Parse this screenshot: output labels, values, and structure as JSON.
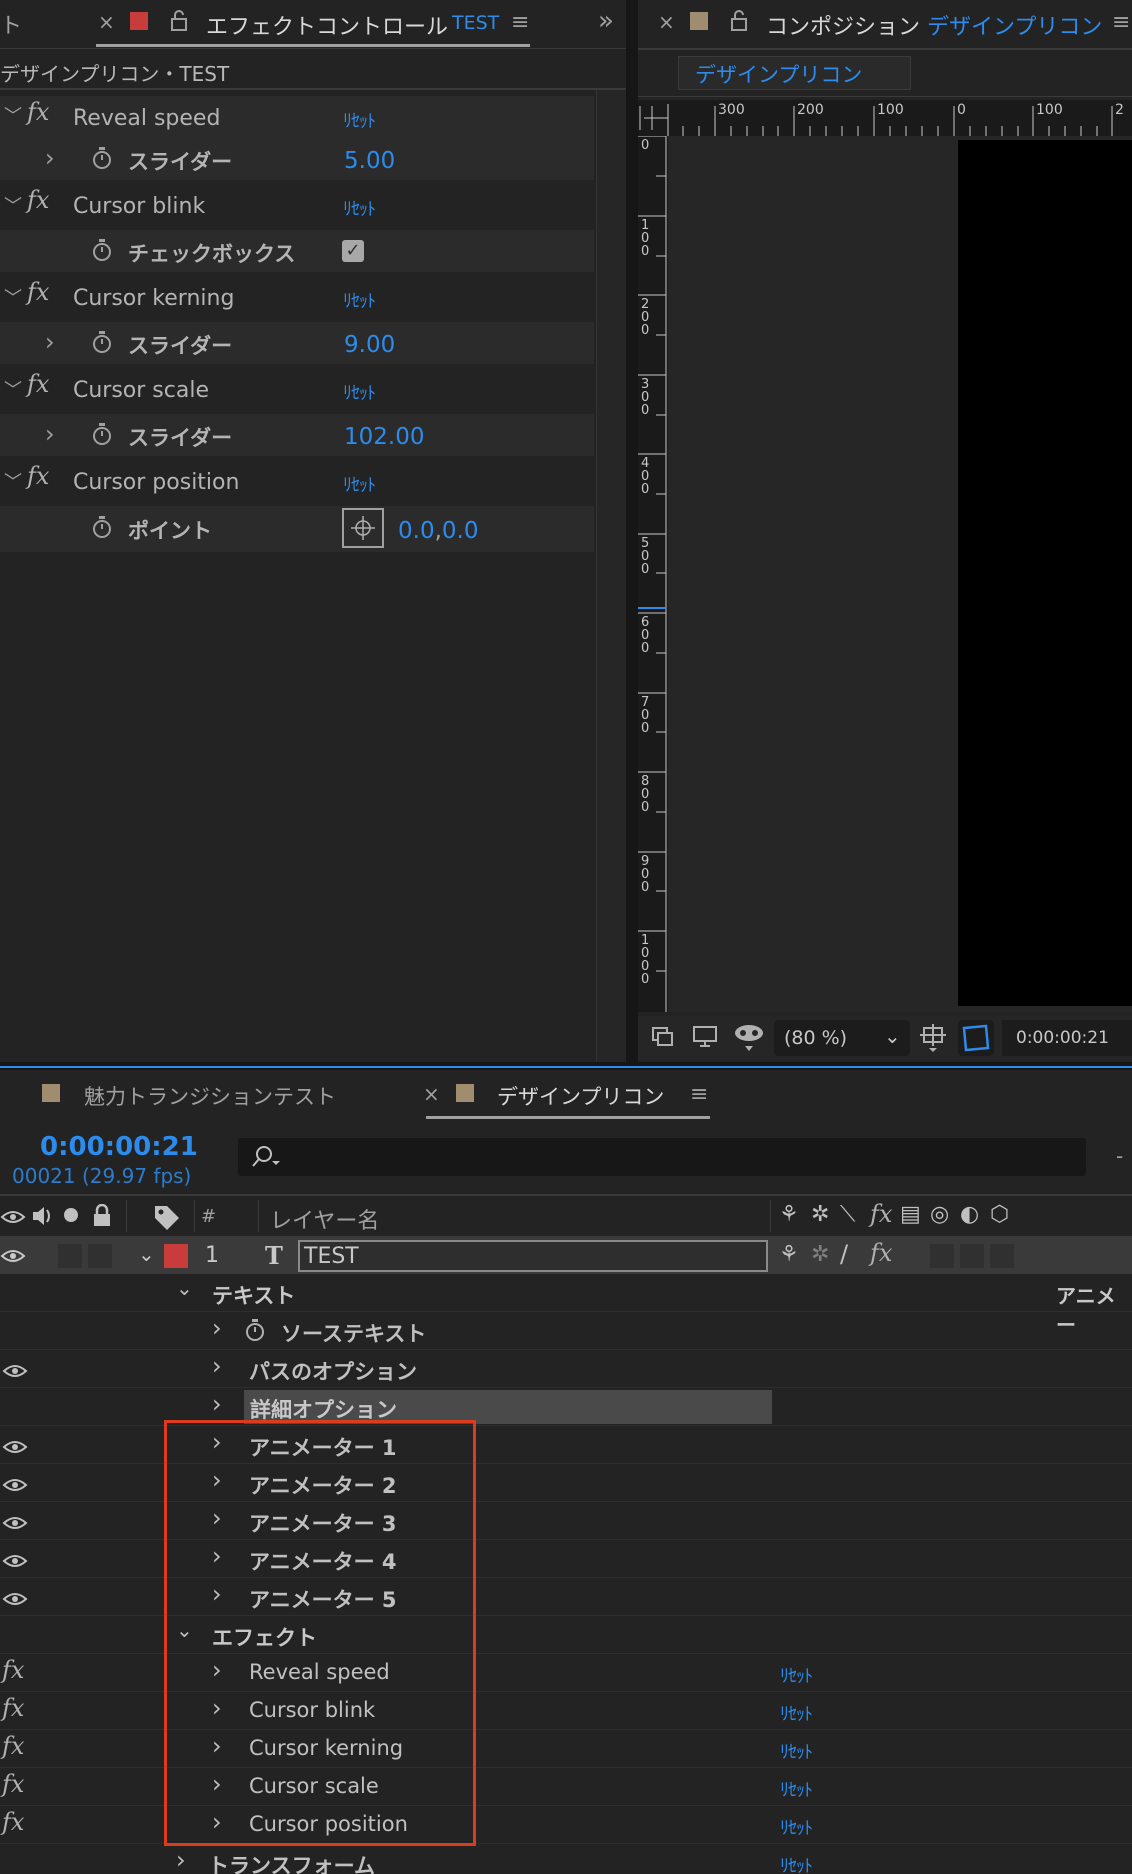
{
  "effect_controls": {
    "tab_left_cut": "ト",
    "tab_title": "エフェクトコントロール",
    "tab_layer": "TEST",
    "breadcrumb": "デザインプリコン・TEST",
    "effects": [
      {
        "name": "Reveal speed",
        "reset": "ﾘｾｯﾄ",
        "param": "スライダー",
        "value": "5.00"
      },
      {
        "name": "Cursor blink",
        "reset": "ﾘｾｯﾄ",
        "param": "チェックボックス",
        "value": "checked"
      },
      {
        "name": "Cursor kerning",
        "reset": "ﾘｾｯﾄ",
        "param": "スライダー",
        "value": "9.00"
      },
      {
        "name": "Cursor scale",
        "reset": "ﾘｾｯﾄ",
        "param": "スライダー",
        "value": "102.00"
      },
      {
        "name": "Cursor position",
        "reset": "ﾘｾｯﾄ",
        "param": "ポイント",
        "value_x": "0.0",
        "value_sep": ",",
        "value_y": "0.0"
      }
    ]
  },
  "composition": {
    "tab_title": "コンポジション",
    "comp_name": "デザインプリコン",
    "flowchart_tab": "デザインプリコン",
    "ruler_h": [
      "300",
      "200",
      "100",
      "0",
      "100",
      "2"
    ],
    "ruler_v": [
      "0",
      "100",
      "200",
      "300",
      "400",
      "500",
      "600",
      "700",
      "800",
      "900",
      "1000"
    ],
    "zoom": "(80 %)",
    "timecode": "0:00:00:21"
  },
  "timeline": {
    "tabs": [
      {
        "label": "魅力トランジションテスト",
        "color": "#a08c6e"
      },
      {
        "label": "デザインプリコン",
        "color": "#a08c6e"
      }
    ],
    "timecode": "0:00:00:21",
    "frame_info": "00021 (29.97 fps)",
    "search_placeholder": "",
    "header": {
      "num": "#",
      "layer_name": "レイヤー名"
    },
    "layer": {
      "index": "1",
      "type": "T",
      "name": "TEST",
      "label_color": "#c83c3c"
    },
    "animate_label": "アニメー",
    "text_group": "テキスト",
    "text_items": [
      "ソーステキスト",
      "パスのオプション",
      "詳細オプション"
    ],
    "animators": [
      "アニメーター 1",
      "アニメーター 2",
      "アニメーター 3",
      "アニメーター 4",
      "アニメーター 5"
    ],
    "effects_group": "エフェクト",
    "effects": [
      "Reveal speed",
      "Cursor blink",
      "Cursor kerning",
      "Cursor scale",
      "Cursor position"
    ],
    "reset_label": "ﾘｾｯﾄ",
    "transform": "トランスフォーム",
    "highlight_color": "#e03a1e"
  }
}
